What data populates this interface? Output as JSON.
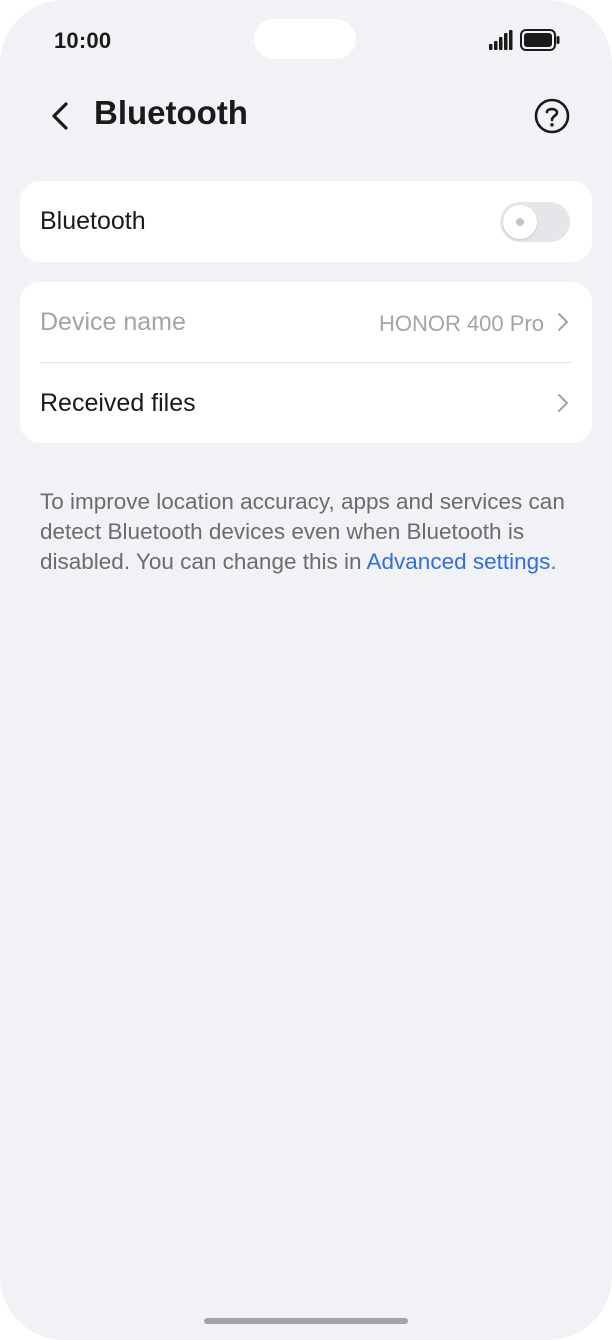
{
  "status_bar": {
    "time": "10:00",
    "icons": [
      "signal-icon",
      "battery-icon"
    ]
  },
  "header": {
    "title": "Bluetooth",
    "back_icon": "chevron-left-icon",
    "help_icon": "help-circle-icon"
  },
  "bluetooth": {
    "label": "Bluetooth",
    "enabled": false
  },
  "device_settings": {
    "device_name_label": "Device name",
    "device_name_value": "HONOR 400 Pro",
    "received_files_label": "Received files"
  },
  "info": {
    "text": "To improve location accuracy, apps and services can detect Bluetooth devices even when Bluetooth is disabled. You can change this in ",
    "link": "Advanced settings",
    "suffix": "."
  },
  "colors": {
    "background": "#f1f2f6",
    "card": "#ffffff",
    "link": "#2f6fe0",
    "secondary_text": "#a3a3a8"
  }
}
